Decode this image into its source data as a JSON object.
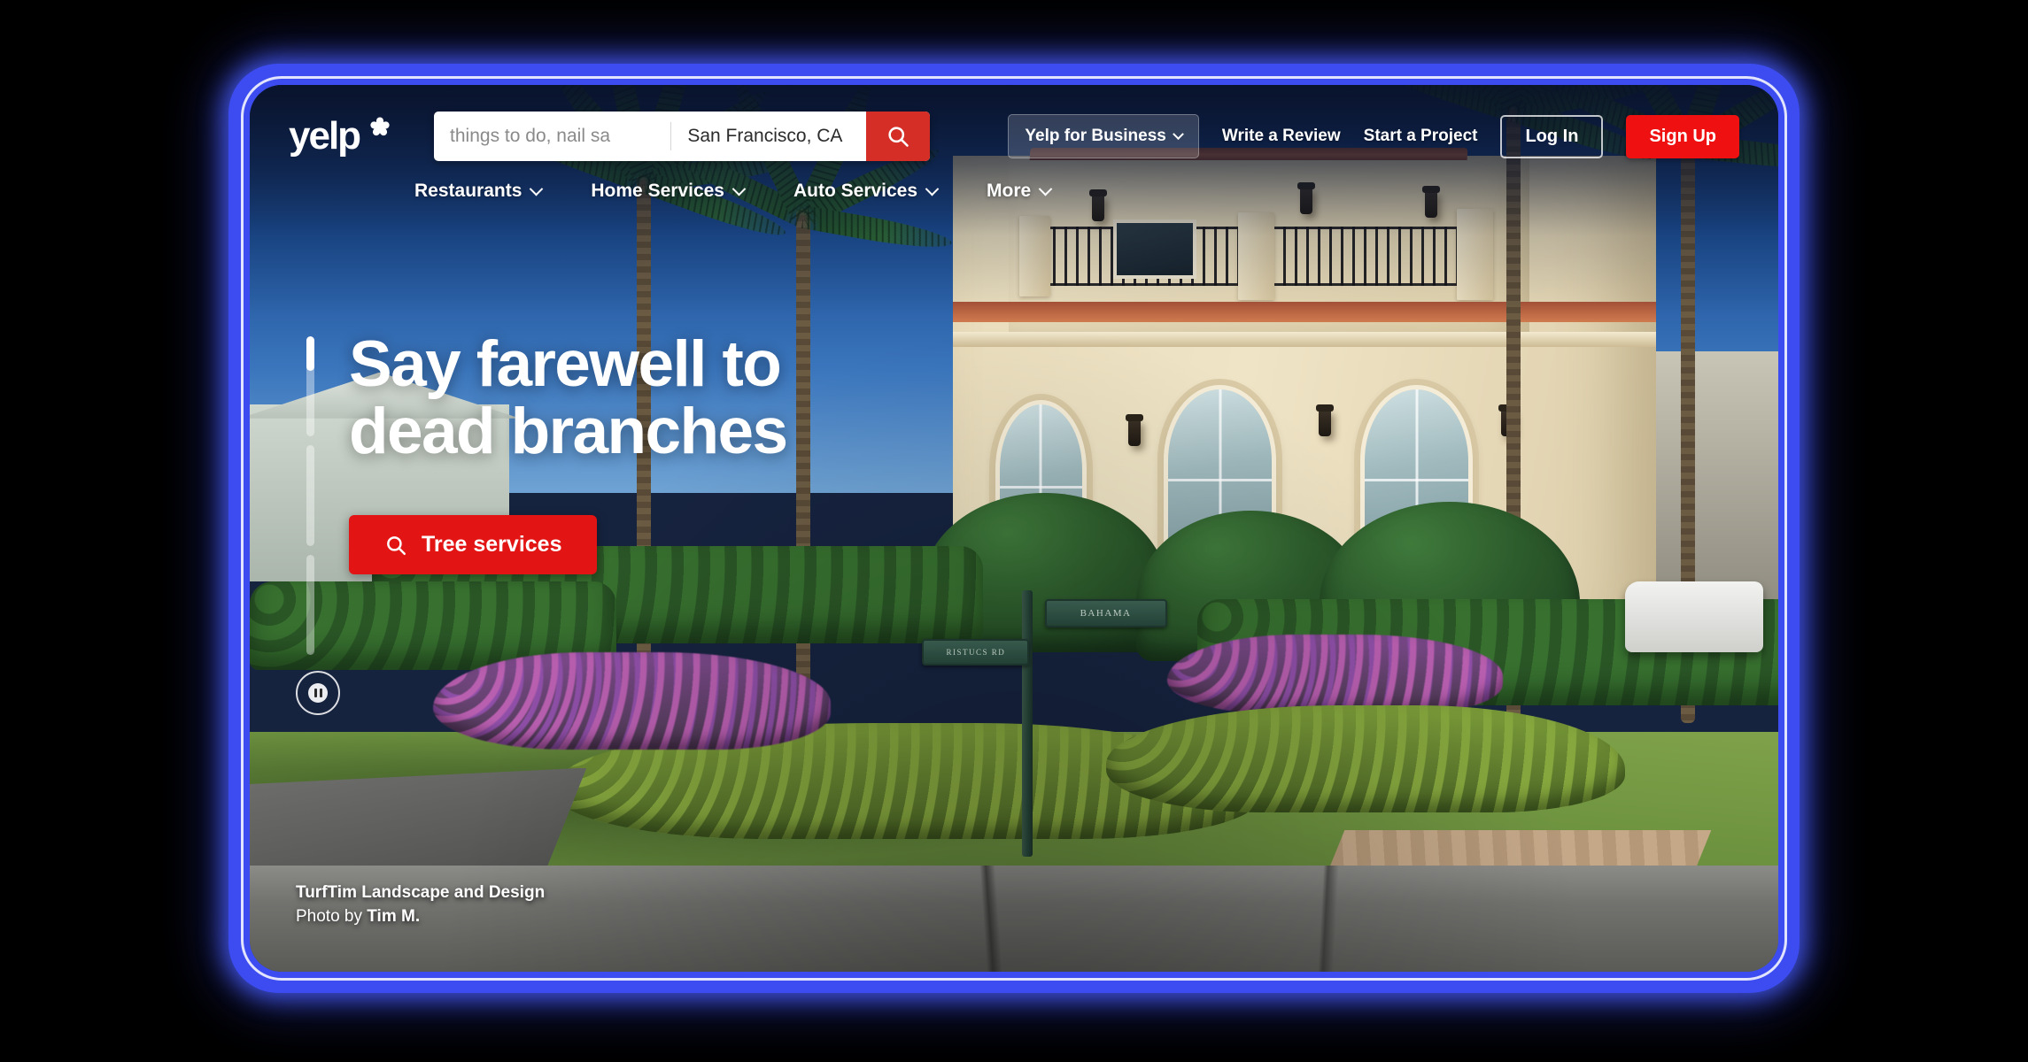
{
  "brand": {
    "logo_text": "yelp",
    "logo_icon": "yelp-burst-icon",
    "accent_red": "#d42e27",
    "signup_red": "#ef1111",
    "cta_red": "#e31414",
    "frame_blue": "#3c4cf0"
  },
  "search": {
    "description_placeholder": "things to do, nail sa",
    "location_value": "San Francisco, CA",
    "search_icon": "magnifier-icon",
    "search_button_label": ""
  },
  "header": {
    "business_menu": "Yelp for Business",
    "write_review": "Write a Review",
    "start_project": "Start a Project",
    "log_in": "Log In",
    "sign_up": "Sign Up"
  },
  "subnav": [
    {
      "label": "Restaurants"
    },
    {
      "label": "Home Services"
    },
    {
      "label": "Auto Services"
    },
    {
      "label": "More"
    }
  ],
  "hero": {
    "headline_line1": "Say farewell to",
    "headline_line2": "dead branches",
    "cta_label": "Tree services",
    "cta_icon": "magnifier-icon",
    "pause_icon": "pause-icon",
    "carousel": {
      "segments": 3,
      "active_index": 0,
      "active_progress_pct": 34
    }
  },
  "attribution": {
    "business_name": "TurfTim Landscape and Design",
    "photo_by_prefix": "Photo by ",
    "photographer": "Tim M."
  },
  "photo": {
    "street_sign_primary": "BAHAMA",
    "street_sign_secondary": "RISTUCS RD"
  }
}
